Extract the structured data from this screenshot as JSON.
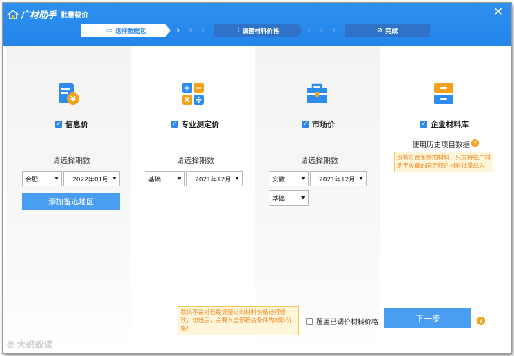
{
  "app": {
    "brand": "广材助手",
    "window_title": "批量载价"
  },
  "steps": [
    {
      "label": "选择数据包",
      "icon": "package-icon",
      "active": true
    },
    {
      "label": "调整材料价格",
      "icon": "sliders-icon",
      "active": false
    },
    {
      "label": "完成",
      "icon": "check-circle-icon",
      "active": false
    }
  ],
  "columns": {
    "info_price": {
      "label": "信息价",
      "checked": true,
      "period_label": "请选择期数",
      "region_value": "合肥",
      "period_value": "2022年01月",
      "add_region_button": "添加备选地区"
    },
    "professional_price": {
      "label": "专业测定价",
      "checked": true,
      "period_label": "请选择期数",
      "type_value": "基础",
      "period_value": "2021年12月"
    },
    "market_price": {
      "label": "市场价",
      "checked": true,
      "period_label": "请选择期数",
      "region_value": "安徽",
      "period_value": "2021年12月",
      "type_value": "基础"
    },
    "enterprise_library": {
      "label": "企业材料库",
      "checked": true,
      "history_label": "使用历史项目数据",
      "hint": "没有符合条件的材料，只支持在广材助手收藏的同定额的材料批量载入"
    }
  },
  "footer": {
    "notice": "默认不会对已经调整过的材料价格进行修改，勾选后，会载入全部符合条件的材料价格！",
    "overwrite_label": "覆盖已调价材料价格",
    "overwrite_checked": false,
    "next_button": "下一步"
  },
  "watermark": "大蚂蚁读",
  "colors": {
    "header_blue": "#2385ea",
    "button_blue": "#4a9ef1",
    "hint_orange": "#f08a2a",
    "hint_bg": "#fff6d9",
    "help_orange": "#f0a21a"
  }
}
